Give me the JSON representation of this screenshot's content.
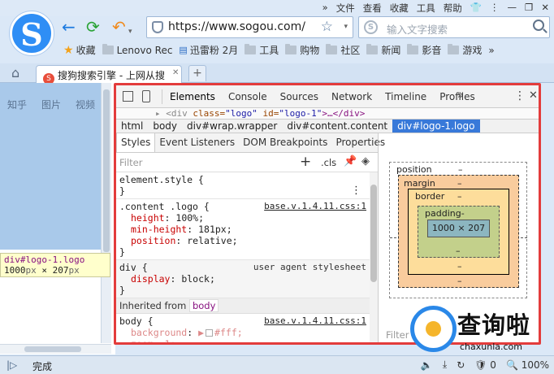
{
  "menubar": {
    "chevrons": "»",
    "items": [
      "文件",
      "查看",
      "收藏",
      "工具",
      "帮助"
    ],
    "controls": [
      "👕",
      "⋮",
      "—",
      "❐",
      "✕"
    ]
  },
  "nav": {
    "back": "←",
    "refresh": "⟳",
    "undo": "↶",
    "dropdown": "▾"
  },
  "address": {
    "url": "https://www.sogou.com/",
    "star": "☆",
    "dropdown": "▾"
  },
  "search": {
    "engine_icon": "S",
    "placeholder": "输入文字搜索"
  },
  "bookmarks": [
    {
      "label": "收藏",
      "icon": "star-icon"
    },
    {
      "label": "Lenovo Rec",
      "icon": "folder-icon"
    },
    {
      "label": "迅雷粉 2月",
      "icon": "page-icon"
    },
    {
      "label": "工具",
      "icon": "folder-icon"
    },
    {
      "label": "购物",
      "icon": "folder-icon"
    },
    {
      "label": "社区",
      "icon": "folder-icon"
    },
    {
      "label": "新闻",
      "icon": "folder-icon"
    },
    {
      "label": "影音",
      "icon": "folder-icon"
    },
    {
      "label": "游戏",
      "icon": "folder-icon"
    }
  ],
  "bookmarks_more": "»",
  "tabs": {
    "home": "⌂",
    "active_title": "搜狗搜索引擎 - 上网从搜",
    "favicon": "S",
    "close": "✕",
    "new_tab": "+"
  },
  "page": {
    "nav_items": [
      "知乎",
      "图片",
      "视频"
    ],
    "tooltip_tag": "div#logo-1.logo",
    "tooltip_w": "1000",
    "tooltip_unit": "px",
    "tooltip_x": " × ",
    "tooltip_h": "207",
    "tooltip_unit2": "px"
  },
  "devtools": {
    "tabs": [
      "Elements",
      "Console",
      "Sources",
      "Network",
      "Timeline",
      "Profiles"
    ],
    "more": "»",
    "kebab": "⋮",
    "close": "✕",
    "html_line": {
      "prefix": "▸ <div ",
      "attr1": "class=",
      "val1": "\"logo\"",
      "attr2": " id=",
      "val2": "\"logo-1\"",
      "suffix": ">…</div>"
    },
    "breadcrumbs": [
      "html",
      "body",
      "div#wrap.wrapper",
      "div#content.content",
      "div#logo-1.logo"
    ],
    "subtabs": [
      "Styles",
      "Event Listeners",
      "DOM Breakpoints",
      "Properties"
    ],
    "filter_placeholder": "Filter",
    "filter_plus": "+",
    "filter_cls": ".cls",
    "filter_pin": "📌",
    "filter_diamond": "◈",
    "rules": {
      "element_style": {
        "selector": "element.style {",
        "close": "}",
        "kebab": "⋮"
      },
      "content_logo": {
        "selector": ".content .logo {",
        "source": "base.v.1.4.11.css:1",
        "decls": [
          {
            "prop": "height",
            "value": " 100%;"
          },
          {
            "prop": "min-height",
            "value": " 181px;"
          },
          {
            "prop": "position",
            "value": " relative;"
          }
        ],
        "close": "}"
      },
      "div_ua": {
        "selector": "div {",
        "source": "user agent stylesheet",
        "decl_prop": "display",
        "decl_value": " block;",
        "close": "}"
      },
      "inherited_label": "Inherited from",
      "inherited_tag": "body",
      "body_rule": {
        "selector": "body {",
        "source": "base.v.1.4.11.css:1",
        "bg_prop": "background",
        "bg_value": "#fff;",
        "bg_arrow": "▶",
        "zoom_prop": "zoom",
        "zoom_value": " 1;"
      }
    },
    "boxmodel": {
      "position_label": "position",
      "position_value": "–",
      "margin_label": "margin",
      "margin_value": "–",
      "border_label": "border",
      "border_value": "–",
      "padding_label": "padding-",
      "content": "1000 × 207",
      "dash": "–"
    },
    "filter2": "Filter"
  },
  "watermark": {
    "text": "查询啦",
    "url": "chaxunla.com"
  },
  "status": {
    "toggle": "|▷",
    "text": "完成",
    "items": [
      "🔈",
      "⤓",
      "↻",
      "🛡 0",
      "🔍 100%"
    ]
  }
}
